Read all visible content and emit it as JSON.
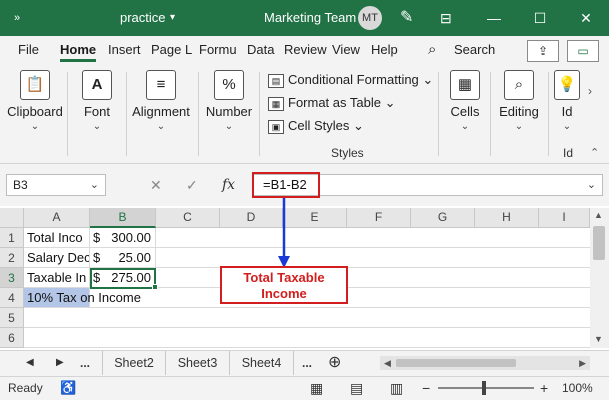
{
  "titlebar": {
    "autosave_icon": "autosave-toggle-icon",
    "workbook": "practice",
    "workbook_chevron": "▾",
    "team": "Marketing Team",
    "user_initials": "MT",
    "pen_icon": "✎",
    "minimize": "—",
    "maximize": "☐",
    "close": "✕"
  },
  "menu": {
    "items": [
      "File",
      "Home",
      "Insert",
      "Page L",
      "Formu",
      "Data",
      "Review",
      "View",
      "Help"
    ],
    "active": "Home",
    "search_icon": "⌕",
    "search_label": "Search",
    "share_icon": "⇪",
    "comment_icon": "▭"
  },
  "ribbon": {
    "clipboard": {
      "label": "Clipboard",
      "icon": "📋",
      "chev": "⌄"
    },
    "font": {
      "label": "Font",
      "icon": "A",
      "chev": "⌄"
    },
    "alignment": {
      "label": "Alignment",
      "icon": "≡",
      "chev": "⌄"
    },
    "number": {
      "label": "Number",
      "icon": "%",
      "chev": "⌄"
    },
    "conditional_formatting": "Conditional Formatting ⌄",
    "format_as_table": "Format as Table ⌄",
    "cell_styles": "Cell Styles ⌄",
    "styles_group_label": "Styles",
    "cells": {
      "label": "Cells",
      "icon": "▦",
      "chev": "⌄"
    },
    "editing": {
      "label": "Editing",
      "icon": "⌕",
      "chev": "⌄"
    },
    "ideas": {
      "label": "Id",
      "icon": "💡",
      "chev": "⌄"
    },
    "ideas_group_label": "Id"
  },
  "formula_bar": {
    "name_box": "B3",
    "name_chevron": "⌄",
    "cancel": "✕",
    "enter": "✓",
    "fx": "fx",
    "formula": "=B1-B2",
    "expand": "⌄"
  },
  "grid": {
    "columns": [
      "A",
      "B",
      "C",
      "D",
      "E",
      "F",
      "G",
      "H",
      "I"
    ],
    "rows": [
      "1",
      "2",
      "3",
      "4",
      "5",
      "6"
    ],
    "cells": {
      "A1": "Total Inco",
      "A2": "Salary Dec",
      "A3": "Taxable In",
      "A4": "10% Tax on Income",
      "B1_symbol": "$",
      "B1_amount": "300.00",
      "B2_symbol": "$",
      "B2_amount": "25.00",
      "B3_symbol": "$",
      "B3_amount": "275.00"
    },
    "active_cell": "B3"
  },
  "annotation": {
    "line1": "Total Taxable",
    "line2": "Income",
    "color": "#d21e1e"
  },
  "sheet_tabs": {
    "prev": "◀",
    "next": "▶",
    "ellipsis_left": "...",
    "tabs": [
      "Sheet2",
      "Sheet3",
      "Sheet4"
    ],
    "ellipsis_right": "...",
    "add": "⊕"
  },
  "status": {
    "ready": "Ready",
    "accessibility_icon": "♿",
    "zoom_minus": "−",
    "zoom_plus": "+",
    "zoom": "100%"
  },
  "colors": {
    "accent": "#217346",
    "highlight_callout": "#d21e1e",
    "arrow": "#1a3ad6",
    "selection_fill": "#b4c6e7"
  }
}
